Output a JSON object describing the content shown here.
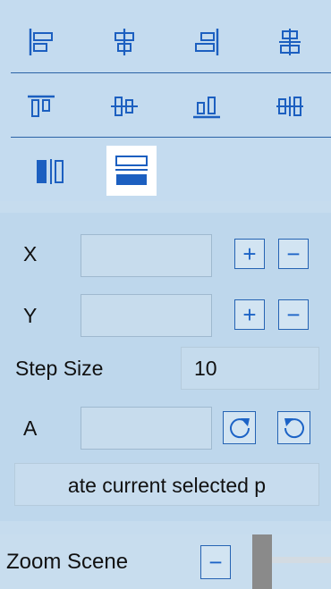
{
  "align_toolbar": {
    "row1_icons": [
      "align-left-icon",
      "align-center-horizontal-icon",
      "align-right-icon",
      "distribute-horizontal-icon"
    ],
    "row2_icons": [
      "align-top-icon",
      "align-middle-vertical-icon",
      "align-bottom-icon",
      "distribute-vertical-icon"
    ],
    "row3_icons": [
      "fill-horizontal-icon",
      "fill-vertical-icon"
    ],
    "active_tool": "fill-vertical-icon"
  },
  "transform": {
    "x_label": "X",
    "x_value": "",
    "y_label": "Y",
    "y_value": "",
    "plus_symbol": "+",
    "minus_symbol": "−",
    "step_label": "Step Size",
    "step_value": "10",
    "a_label": "A",
    "a_value": "",
    "rotate_cw_icon": "rotate-clockwise-icon",
    "rotate_ccw_icon": "rotate-counterclockwise-icon"
  },
  "status": {
    "text": "ate current selected p"
  },
  "zoom": {
    "label": "Zoom Scene",
    "minus_symbol": "−"
  },
  "colors": {
    "accent": "#2563b3",
    "icon_blue": "#1c5fc0",
    "active_bg": "#ffffff",
    "panel_bg": "#c4dbef"
  }
}
